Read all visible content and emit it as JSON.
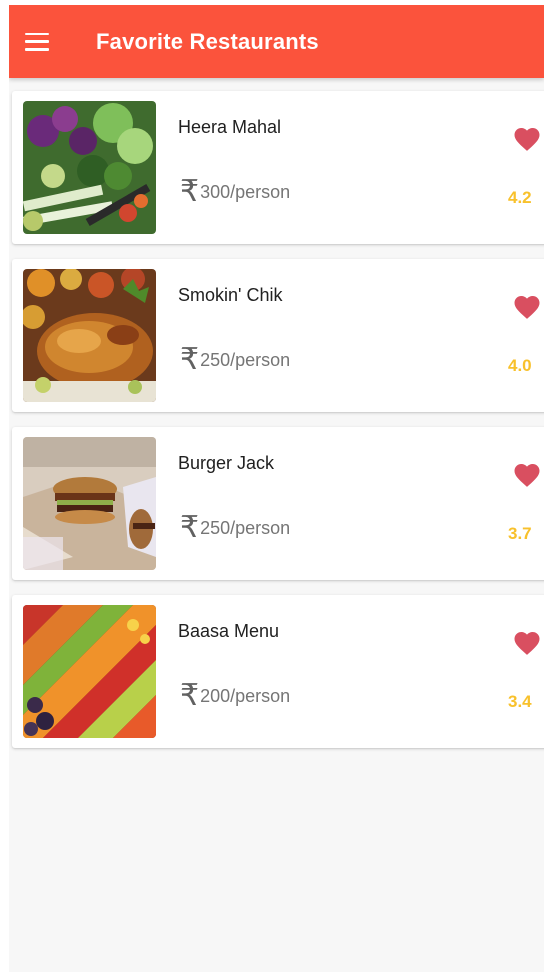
{
  "app_bar": {
    "title": "Favorite Restaurants",
    "menu_icon": "hamburger-menu-icon",
    "background": "#fb533c"
  },
  "restaurants": [
    {
      "name": "Heera Mahal",
      "currency_symbol": "₹",
      "price": "300/person",
      "rating": "4.2",
      "favorite": true,
      "image": "vegetables-photo"
    },
    {
      "name": "Smokin' Chik",
      "currency_symbol": "₹",
      "price": "250/person",
      "rating": "4.0",
      "favorite": true,
      "image": "roast-chicken-photo"
    },
    {
      "name": "Burger Jack",
      "currency_symbol": "₹",
      "price": "250/person",
      "rating": "3.7",
      "favorite": true,
      "image": "burgers-photo"
    },
    {
      "name": "Baasa Menu",
      "currency_symbol": "₹",
      "price": "200/person",
      "rating": "3.4",
      "favorite": true,
      "image": "produce-market-photo"
    }
  ],
  "colors": {
    "heart": "#d94f60",
    "rating": "#f8c12c",
    "price": "#757575"
  }
}
